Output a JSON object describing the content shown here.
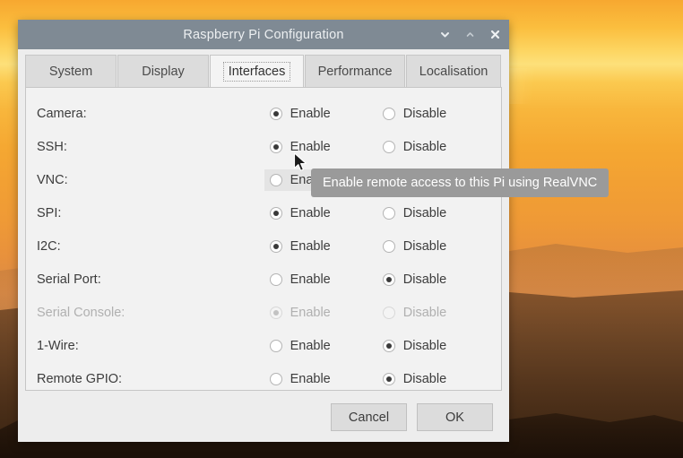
{
  "window": {
    "title": "Raspberry Pi Configuration",
    "controls": [
      {
        "name": "minimize",
        "icon": "chevron-down-icon"
      },
      {
        "name": "maximize",
        "icon": "chevron-up-icon"
      },
      {
        "name": "close",
        "icon": "close-icon"
      }
    ]
  },
  "tabs": [
    {
      "label": "System",
      "active": false
    },
    {
      "label": "Display",
      "active": false
    },
    {
      "label": "Interfaces",
      "active": true
    },
    {
      "label": "Performance",
      "active": false
    },
    {
      "label": "Localisation",
      "active": false
    }
  ],
  "options": {
    "enable_label": "Enable",
    "disable_label": "Disable"
  },
  "rows": [
    {
      "label": "Camera:",
      "selected": "enable",
      "disabled": false,
      "hover": null
    },
    {
      "label": "SSH:",
      "selected": "enable",
      "disabled": false,
      "hover": null
    },
    {
      "label": "VNC:",
      "selected": "disable",
      "disabled": false,
      "hover": "enable"
    },
    {
      "label": "SPI:",
      "selected": "enable",
      "disabled": false,
      "hover": null
    },
    {
      "label": "I2C:",
      "selected": "enable",
      "disabled": false,
      "hover": null
    },
    {
      "label": "Serial Port:",
      "selected": "disable",
      "disabled": false,
      "hover": null
    },
    {
      "label": "Serial Console:",
      "selected": "enable",
      "disabled": true,
      "hover": null
    },
    {
      "label": "1-Wire:",
      "selected": "disable",
      "disabled": false,
      "hover": null
    },
    {
      "label": "Remote GPIO:",
      "selected": "disable",
      "disabled": false,
      "hover": null
    }
  ],
  "tooltip": {
    "text": "Enable remote access to this Pi using RealVNC"
  },
  "footer": {
    "cancel_label": "Cancel",
    "ok_label": "OK"
  },
  "colors": {
    "titlebar": "#7f8a94",
    "window_bg": "#ededed",
    "panel_bg": "#f2f2f2",
    "tab_active_bg": "#f4f4f4",
    "tab_inactive_bg": "#dcdcdc",
    "tooltip_bg": "#9a9a9a",
    "tooltip_text": "#ffffff",
    "radio_dot": "#3a3a3a"
  }
}
